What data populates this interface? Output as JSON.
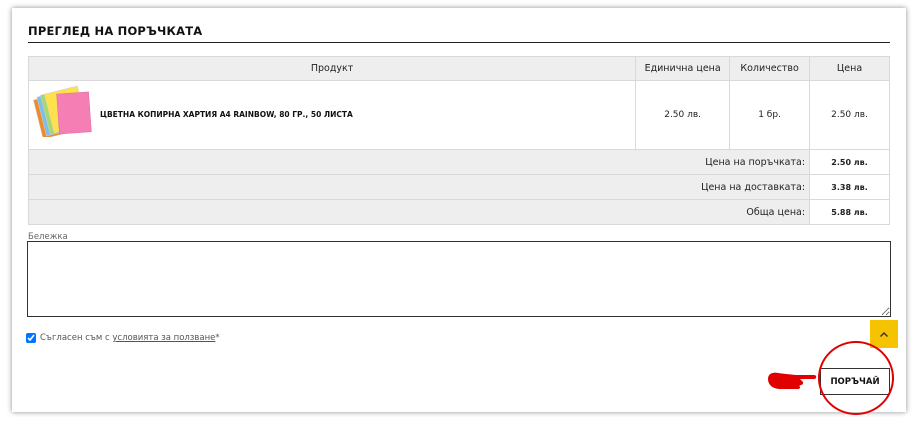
{
  "section": {
    "title": "ПРЕГЛЕД НА ПОРЪЧКАТА"
  },
  "table": {
    "headers": {
      "product": "Продукт",
      "unit_price": "Единична цена",
      "quantity": "Количество",
      "price": "Цена"
    },
    "items": [
      {
        "name": "ЦВЕТНА КОПИРНА ХАРТИЯ A4 RAINBOW, 80 ГР., 50 ЛИСТА",
        "unit_price": "2.50 лв.",
        "quantity": "1 бр.",
        "price": "2.50 лв."
      }
    ],
    "summary": {
      "order_label": "Цена на поръчката:",
      "order_value": "2.50 лв.",
      "delivery_label": "Цена на доставката:",
      "delivery_value": "3.38 лв.",
      "total_label": "Обща цена:",
      "total_value": "5.88 лв."
    }
  },
  "note": {
    "label": "Бележка",
    "value": ""
  },
  "agree": {
    "text": "Съгласен съм с ",
    "link": "условията за ползване",
    "required": "*",
    "checked": true
  },
  "order_button": {
    "label": "ПОРЪЧАЙ"
  },
  "icons": {
    "product_image": "paper-stack-icon",
    "scroll_top": "chevron-up-icon",
    "pointer": "pointing-hand-icon"
  },
  "colors": {
    "scroll_top_bg": "#f5c300",
    "highlight_circle": "#e00000",
    "pointer_hand": "#e00000"
  }
}
